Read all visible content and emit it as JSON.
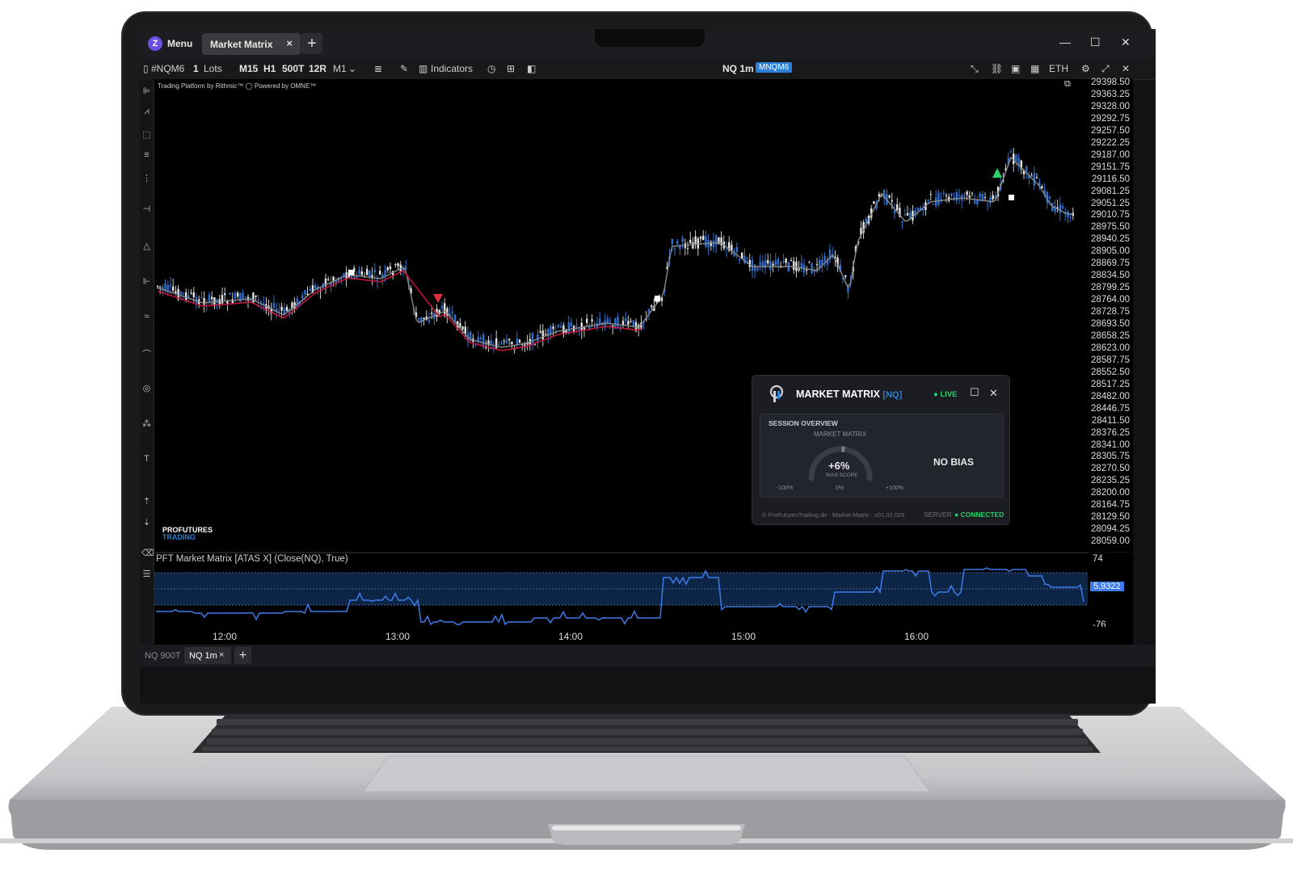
{
  "app": {
    "menu_label": "Menu",
    "tab_label": "Market Matrix",
    "tab_close": "×",
    "new_tab": "+",
    "win_min": "—",
    "win_max": "☐",
    "win_close": "✕"
  },
  "toolbar": {
    "symbol": "#NQM6",
    "qty": "1",
    "qty_unit": "Lots",
    "timeframes": [
      "M15",
      "H1",
      "500T",
      "12R",
      "M1"
    ],
    "indicators_label": "Indicators",
    "chart_title": "NQ 1m",
    "contract_badge": "MNQM6",
    "session": "ETH"
  },
  "chart": {
    "watermark_left": "Trading Platform by Rithmic™",
    "watermark_right": "Powered by OMNE™",
    "brand_line1": "PROFUTURES",
    "brand_line2": "TRADING",
    "price_labels": [
      "29398.50",
      "29363.25",
      "29328.00",
      "29292.75",
      "29257.50",
      "29222.25",
      "29187.00",
      "29151.75",
      "29116.50",
      "29081.25",
      "29051.25",
      "29010.75",
      "28975.50",
      "28940.25",
      "28905.00",
      "28869.75",
      "28834.50",
      "28799.25",
      "28764.00",
      "28728.75",
      "28693.50",
      "28658.25",
      "28623.00",
      "28587.75",
      "28552.50",
      "28517.25",
      "28482.00",
      "28446.75",
      "28411.50",
      "28376.25",
      "28341.00",
      "28305.75",
      "28270.50",
      "28235.25",
      "28200.00",
      "28164.75",
      "28129.50",
      "28094.25",
      "28059.00"
    ],
    "time_labels": [
      "12:00",
      "13:00",
      "14:00",
      "15:00",
      "16:00"
    ]
  },
  "indicator": {
    "title": "PFT Market Matrix [ATAS X] (Close(NQ), True)",
    "top_value": "74",
    "bottom_value": "-76",
    "current_value": "5,9322"
  },
  "bottom_tabs": {
    "tab1": "NQ 900T",
    "tab2": "NQ 1m",
    "tab2_close": "×",
    "add": "+"
  },
  "market_matrix": {
    "title": "MARKET MATRIX",
    "symbol": "[NQ]",
    "live": "● LIVE",
    "section": "SESSION OVERVIEW",
    "gauge_title": "MARKET MATRIX",
    "score": "+6%",
    "score_label": "BIAS SCORE",
    "min_label": "-100%",
    "mid_label": "0%",
    "max_label": "+100%",
    "bias": "NO BIAS",
    "footer": "© ProFuturesTrading.de · Market Matrix · v01.02.029",
    "server_label": "SERVER",
    "connected": "● CONNECTED",
    "score_value": 6
  },
  "colors": {
    "accent_blue": "#2b7fd6",
    "candle_blue": "#2f6fd0",
    "ma_red": "#c0143c",
    "live_green": "#27d16a",
    "indicator_line": "#3d7bea"
  }
}
